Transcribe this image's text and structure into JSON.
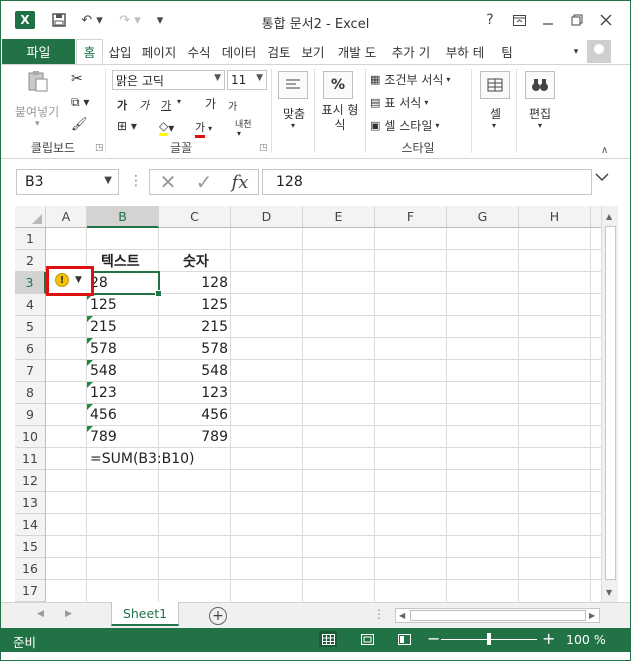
{
  "window": {
    "title": "통합 문서2 - Excel",
    "help": "?",
    "controls": [
      "ribbon-display",
      "minimize",
      "restore",
      "close"
    ]
  },
  "tabs": {
    "file": "파일",
    "items": [
      "홈",
      "삽입",
      "페이지",
      "수식",
      "데이터",
      "검토",
      "보기",
      "개발 도",
      "추가 기",
      "부하 테",
      "팀"
    ],
    "active": "홈"
  },
  "ribbon": {
    "clipboard": {
      "paste": "붙여넣기",
      "label": "클립보드"
    },
    "font": {
      "name": "맑은 고딕",
      "size": "11",
      "label": "글꼴",
      "grow": "가",
      "shrink": "가",
      "bold": "가",
      "italic": "가",
      "underline": "가",
      "font_color": "가",
      "phonetic": "내천"
    },
    "alignment": {
      "label": "맞춤"
    },
    "number": {
      "label": "표시 형식",
      "icon": "%"
    },
    "styles": {
      "conditional": "조건부 서식",
      "table": "표 서식",
      "cell_styles": "셀 스타일",
      "label": "스타일"
    },
    "cells": {
      "label": "셀"
    },
    "editing": {
      "label": "편집"
    }
  },
  "formula_bar": {
    "name_box": "B3",
    "fx": "fx",
    "value": "128"
  },
  "grid": {
    "columns": [
      "A",
      "B",
      "C",
      "D",
      "E",
      "F",
      "G",
      "H"
    ],
    "selected_column": "B",
    "rows": [
      "1",
      "2",
      "3",
      "4",
      "5",
      "6",
      "7",
      "8",
      "9",
      "10",
      "11",
      "12",
      "13",
      "14",
      "15",
      "16",
      "17"
    ],
    "selected_row": "3",
    "headers": {
      "text": "텍스트",
      "number": "숫자"
    },
    "text_values": [
      "28",
      "125",
      "215",
      "578",
      "548",
      "123",
      "456",
      "789"
    ],
    "number_values": [
      "128",
      "125",
      "215",
      "578",
      "548",
      "123",
      "456",
      "789"
    ],
    "formula": "=SUM(B3:B10)",
    "warning_symbol": "!"
  },
  "sheets": {
    "active": "Sheet1"
  },
  "status": {
    "text": "준비",
    "zoom": "100 %",
    "zoom_minus": "−",
    "zoom_plus": "+"
  }
}
